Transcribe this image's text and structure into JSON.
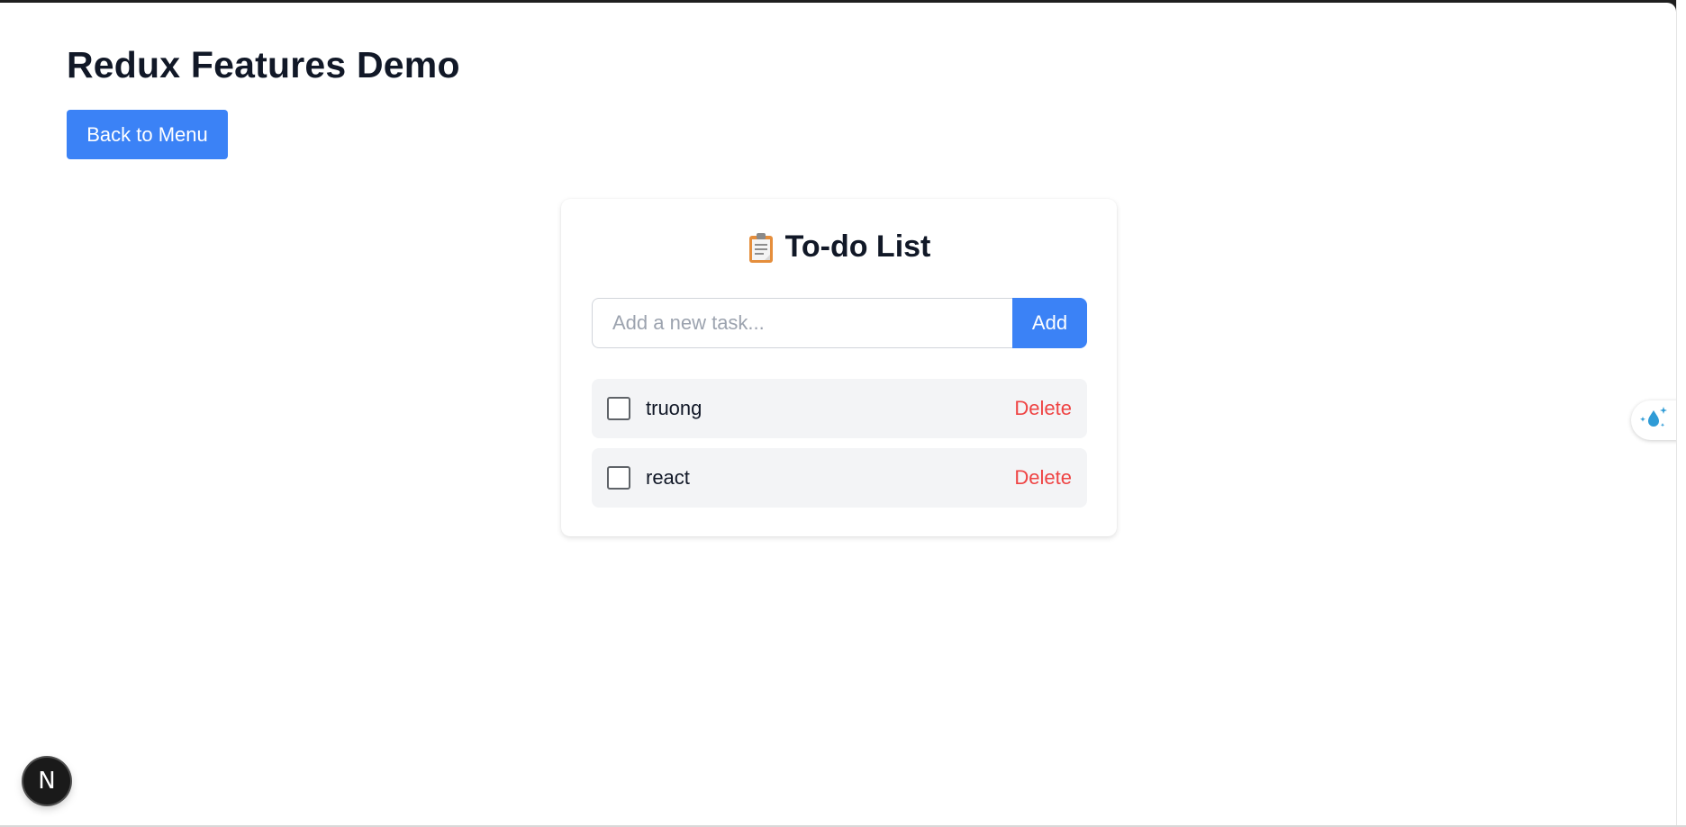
{
  "page": {
    "title": "Redux Features Demo",
    "back_button_label": "Back to Menu"
  },
  "todo": {
    "header_icon": "clipboard-icon",
    "title": "To-do List",
    "input": {
      "placeholder": "Add a new task...",
      "value": ""
    },
    "add_label": "Add",
    "items": [
      {
        "text": "truong",
        "completed": false,
        "delete_label": "Delete"
      },
      {
        "text": "react",
        "completed": false,
        "delete_label": "Delete"
      }
    ]
  },
  "overlays": {
    "dev_badge_letter": "N",
    "extension_icon": "water-drop-sparkle-icon"
  },
  "colors": {
    "primary": "#3b82f6",
    "danger": "#ef4444",
    "heading": "#111827",
    "item_background": "#f3f4f6"
  }
}
